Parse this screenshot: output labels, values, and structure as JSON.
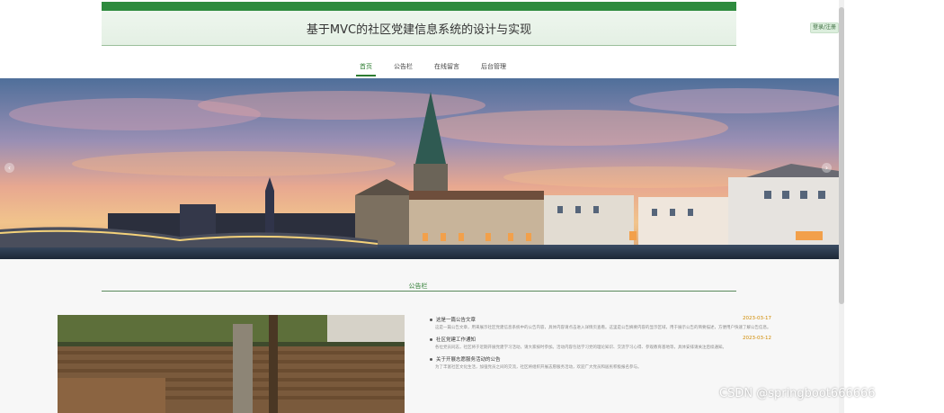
{
  "header": {
    "title": "基于MVC的社区党建信息系统的设计与实现",
    "login_label": "登录/注册"
  },
  "nav": {
    "items": [
      {
        "label": "首页",
        "active": true
      },
      {
        "label": "公告栏",
        "active": false
      },
      {
        "label": "在线留言",
        "active": false
      },
      {
        "label": "后台管理",
        "active": false
      }
    ]
  },
  "banner": {
    "prev": "‹",
    "next": "›"
  },
  "notices": {
    "section_title": "公告栏",
    "items": [
      {
        "title": "这是一篇公告文章",
        "date": "2023-03-17",
        "body": "这是一篇公告文章，用来展示社区党建信息系统中的公告内容，具体内容请点击进入详情页查看。这里是公告摘要内容的显示区域，用于展示公告的简要描述，方便用户快速了解公告信息。"
      },
      {
        "title": "社区党建工作通知",
        "date": "2023-03-12",
        "body": "各位党员同志，社区将于近期开展党建学习活动，请大家按时参加。活动内容包括学习党的理论知识、交流学习心得、参观教育基地等，具体安排请关注后续通知。"
      },
      {
        "title": "关于开展志愿服务活动的公告",
        "date": "",
        "body": "为了丰富社区文化生活，加强党员之间的交流，社区将组织开展志愿服务活动，欢迎广大党员和居民积极报名参与。"
      }
    ]
  },
  "watermark": "CSDN @springboot666666",
  "colors": {
    "brand_green": "#2e8b3e",
    "date_orange": "#d08a00"
  }
}
